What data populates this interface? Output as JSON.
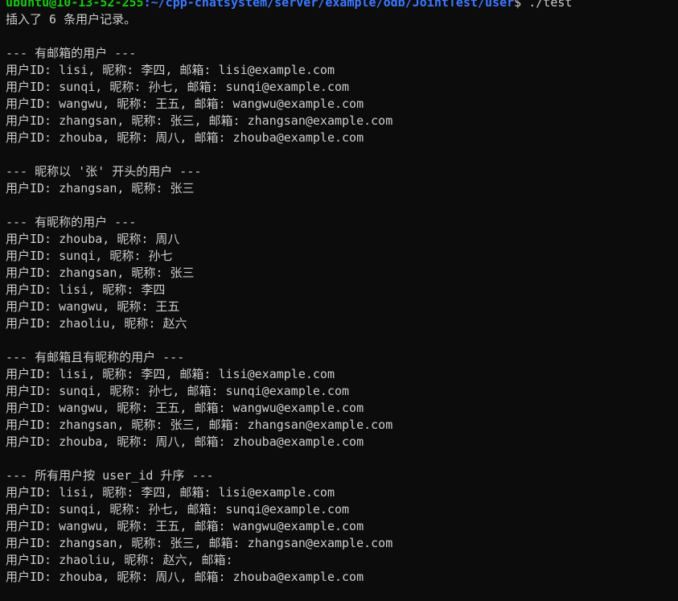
{
  "prompt": {
    "user_host": "ubuntu@10-13-52-255",
    "path": ":~/cpp-chatsystem/server/example/odb/JointTest/user",
    "tail": "$ ./test"
  },
  "output_lines": [
    "插入了 6 条用户记录。",
    "",
    "--- 有邮箱的用户 ---",
    "用户ID: lisi, 昵称: 李四, 邮箱: lisi@example.com",
    "用户ID: sunqi, 昵称: 孙七, 邮箱: sunqi@example.com",
    "用户ID: wangwu, 昵称: 王五, 邮箱: wangwu@example.com",
    "用户ID: zhangsan, 昵称: 张三, 邮箱: zhangsan@example.com",
    "用户ID: zhouba, 昵称: 周八, 邮箱: zhouba@example.com",
    "",
    "--- 昵称以 '张' 开头的用户 ---",
    "用户ID: zhangsan, 昵称: 张三",
    "",
    "--- 有昵称的用户 ---",
    "用户ID: zhouba, 昵称: 周八",
    "用户ID: sunqi, 昵称: 孙七",
    "用户ID: zhangsan, 昵称: 张三",
    "用户ID: lisi, 昵称: 李四",
    "用户ID: wangwu, 昵称: 王五",
    "用户ID: zhaoliu, 昵称: 赵六",
    "",
    "--- 有邮箱且有昵称的用户 ---",
    "用户ID: lisi, 昵称: 李四, 邮箱: lisi@example.com",
    "用户ID: sunqi, 昵称: 孙七, 邮箱: sunqi@example.com",
    "用户ID: wangwu, 昵称: 王五, 邮箱: wangwu@example.com",
    "用户ID: zhangsan, 昵称: 张三, 邮箱: zhangsan@example.com",
    "用户ID: zhouba, 昵称: 周八, 邮箱: zhouba@example.com",
    "",
    "--- 所有用户按 user_id 升序 ---",
    "用户ID: lisi, 昵称: 李四, 邮箱: lisi@example.com",
    "用户ID: sunqi, 昵称: 孙七, 邮箱: sunqi@example.com",
    "用户ID: wangwu, 昵称: 王五, 邮箱: wangwu@example.com",
    "用户ID: zhangsan, 昵称: 张三, 邮箱: zhangsan@example.com",
    "用户ID: zhaoliu, 昵称: 赵六, 邮箱: ",
    "用户ID: zhouba, 昵称: 周八, 邮箱: zhouba@example.com"
  ]
}
